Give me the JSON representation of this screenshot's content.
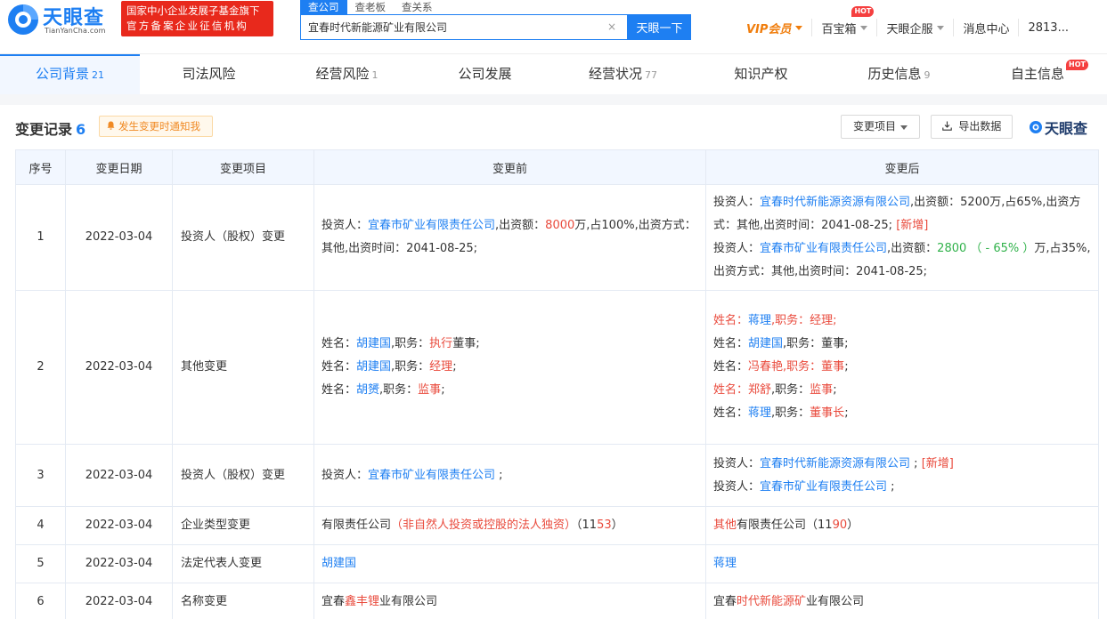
{
  "header": {
    "logo_text": "天眼查",
    "logo_sub": "TianYanCha.com",
    "official_line1": "国家中小企业发展子基金旗下",
    "official_line2": "官方备案企业征信机构",
    "search_tabs": [
      "查公司",
      "查老板",
      "查关系"
    ],
    "search_value": "宜春时代新能源矿业有限公司",
    "search_clear": "×",
    "search_button": "天眼一下",
    "nav": {
      "vip": "VIP会员",
      "treasure": "百宝箱",
      "hot": "HOT",
      "enterprise": "天眼企服",
      "messages": "消息中心",
      "user": "2813..."
    }
  },
  "tabs": [
    {
      "label": "公司背景",
      "count": "21"
    },
    {
      "label": "司法风险",
      "count": ""
    },
    {
      "label": "经营风险",
      "count": "1"
    },
    {
      "label": "公司发展",
      "count": ""
    },
    {
      "label": "经营状况",
      "count": "77"
    },
    {
      "label": "知识产权",
      "count": ""
    },
    {
      "label": "历史信息",
      "count": "9"
    },
    {
      "label": "自主信息",
      "count": "",
      "hot": "HOT"
    }
  ],
  "section": {
    "title": "变更记录",
    "count": "6",
    "notify": "发生变更时通知我",
    "filter": "变更项目",
    "export": "导出数据",
    "brand": "天眼查"
  },
  "table": {
    "headers": [
      "序号",
      "变更日期",
      "变更项目",
      "变更前",
      "变更后"
    ],
    "rows": [
      {
        "idx": "1",
        "date": "2022-03-04",
        "item": "投资人（股权）变更",
        "before": [
          [
            [
              "投资人：",
              ""
            ],
            [
              "宜春市矿业有限责任公司",
              "blue"
            ],
            [
              ",出资额：",
              ""
            ],
            [
              "8000",
              "red"
            ],
            [
              "万,占100%,出资方式：其他,出资时间：2041-08-25;",
              ""
            ]
          ]
        ],
        "after": [
          [
            [
              "投资人：",
              ""
            ],
            [
              "宜春时代新能源资源有限公司",
              "blue"
            ],
            [
              ",出资额：5200万,占65%,出资方式：其他,出资时间：2041-08-25; ",
              ""
            ],
            [
              "[新增]",
              "red"
            ]
          ],
          [
            [
              "投资人：",
              ""
            ],
            [
              "宜春市矿业有限责任公司",
              "blue"
            ],
            [
              ",出资额：",
              ""
            ],
            [
              "2800 （ - 65% ）",
              "green"
            ],
            [
              "万,占35%,出资方式：其他,出资时间：2041-08-25;",
              ""
            ]
          ]
        ]
      },
      {
        "idx": "2",
        "date": "2022-03-04",
        "item": "其他变更",
        "before": [
          [
            [
              "姓名：",
              ""
            ],
            [
              "胡建国",
              "blue"
            ],
            [
              ",职务：",
              ""
            ],
            [
              "执行",
              "red"
            ],
            [
              "董事;",
              ""
            ]
          ],
          [
            [
              "姓名：",
              ""
            ],
            [
              "胡建国",
              "blue"
            ],
            [
              ",职务：",
              ""
            ],
            [
              "经理",
              "red"
            ],
            [
              ";",
              ""
            ]
          ],
          [
            [
              "姓名：",
              ""
            ],
            [
              "胡赟",
              "blue"
            ],
            [
              ",职务：",
              ""
            ],
            [
              "监事",
              "red"
            ],
            [
              ";",
              ""
            ]
          ]
        ],
        "after": [
          [
            [
              "姓名：",
              "red"
            ],
            [
              "蒋理",
              "blue"
            ],
            [
              ",职务：经理;",
              "red"
            ]
          ],
          [
            [
              "姓名：",
              ""
            ],
            [
              "胡建国",
              "blue"
            ],
            [
              ",职务：董事;",
              ""
            ]
          ],
          [
            [
              "姓名：",
              ""
            ],
            [
              "冯春艳",
              "red"
            ],
            [
              ",职务：",
              "red"
            ],
            [
              "董事",
              "red"
            ],
            [
              ";",
              ""
            ]
          ],
          [
            [
              "姓名：",
              "red"
            ],
            [
              "郑舒",
              "red"
            ],
            [
              ",职务：",
              ""
            ],
            [
              "监事",
              "red"
            ],
            [
              ";",
              ""
            ]
          ],
          [
            [
              "姓名：",
              ""
            ],
            [
              "蒋理",
              "blue"
            ],
            [
              ",职务：",
              ""
            ],
            [
              "董事长",
              "red"
            ],
            [
              ";",
              ""
            ]
          ]
        ]
      },
      {
        "idx": "3",
        "date": "2022-03-04",
        "item": "投资人（股权）变更",
        "before": [
          [
            [
              "投资人：",
              ""
            ],
            [
              "宜春市矿业有限责任公司",
              "blue"
            ],
            [
              " ;",
              ""
            ]
          ]
        ],
        "after": [
          [
            [
              "投资人：",
              ""
            ],
            [
              "宜春时代新能源资源有限公司",
              "blue"
            ],
            [
              " ; ",
              ""
            ],
            [
              "[新增]",
              "red"
            ]
          ],
          [
            [
              "投资人：",
              ""
            ],
            [
              "宜春市矿业有限责任公司",
              "blue"
            ],
            [
              " ;",
              ""
            ]
          ]
        ]
      },
      {
        "idx": "4",
        "date": "2022-03-04",
        "item": "企业类型变更",
        "before": [
          [
            [
              "有限责任公司",
              ""
            ],
            [
              "（非自然人投资或控股的法人独资）",
              "red"
            ],
            [
              "（11",
              ""
            ],
            [
              "53",
              "red"
            ],
            [
              "）",
              ""
            ]
          ]
        ],
        "after": [
          [
            [
              "其他",
              "red"
            ],
            [
              "有限责任公司（11",
              ""
            ],
            [
              "90",
              "red"
            ],
            [
              "）",
              ""
            ]
          ]
        ]
      },
      {
        "idx": "5",
        "date": "2022-03-04",
        "item": "法定代表人变更",
        "before": [
          [
            [
              "胡建国",
              "blue"
            ]
          ]
        ],
        "after": [
          [
            [
              "蒋理",
              "blue"
            ]
          ]
        ]
      },
      {
        "idx": "6",
        "date": "2022-03-04",
        "item": "名称变更",
        "before": [
          [
            [
              "宜春",
              ""
            ],
            [
              "鑫丰锂",
              "red"
            ],
            [
              "业有限公司",
              ""
            ]
          ]
        ],
        "after": [
          [
            [
              "宜春",
              ""
            ],
            [
              "时代新能源矿",
              "red"
            ],
            [
              "业有限公司",
              ""
            ]
          ]
        ]
      }
    ]
  }
}
